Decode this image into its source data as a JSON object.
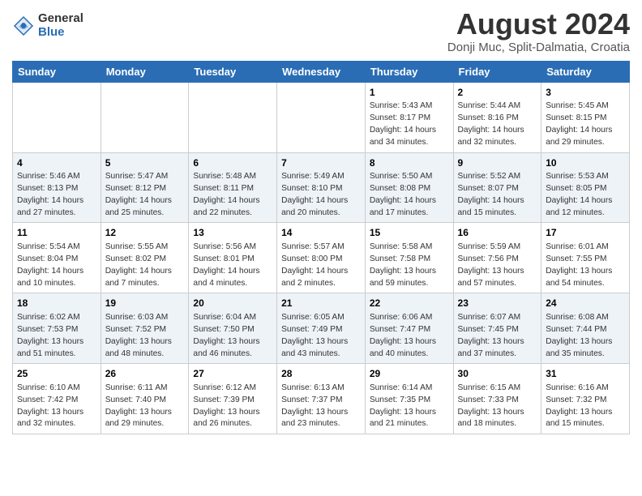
{
  "header": {
    "logo_general": "General",
    "logo_blue": "Blue",
    "month_title": "August 2024",
    "location": "Donji Muc, Split-Dalmatia, Croatia"
  },
  "weekdays": [
    "Sunday",
    "Monday",
    "Tuesday",
    "Wednesday",
    "Thursday",
    "Friday",
    "Saturday"
  ],
  "weeks": [
    [
      {
        "day": "",
        "info": ""
      },
      {
        "day": "",
        "info": ""
      },
      {
        "day": "",
        "info": ""
      },
      {
        "day": "",
        "info": ""
      },
      {
        "day": "1",
        "info": "Sunrise: 5:43 AM\nSunset: 8:17 PM\nDaylight: 14 hours\nand 34 minutes."
      },
      {
        "day": "2",
        "info": "Sunrise: 5:44 AM\nSunset: 8:16 PM\nDaylight: 14 hours\nand 32 minutes."
      },
      {
        "day": "3",
        "info": "Sunrise: 5:45 AM\nSunset: 8:15 PM\nDaylight: 14 hours\nand 29 minutes."
      }
    ],
    [
      {
        "day": "4",
        "info": "Sunrise: 5:46 AM\nSunset: 8:13 PM\nDaylight: 14 hours\nand 27 minutes."
      },
      {
        "day": "5",
        "info": "Sunrise: 5:47 AM\nSunset: 8:12 PM\nDaylight: 14 hours\nand 25 minutes."
      },
      {
        "day": "6",
        "info": "Sunrise: 5:48 AM\nSunset: 8:11 PM\nDaylight: 14 hours\nand 22 minutes."
      },
      {
        "day": "7",
        "info": "Sunrise: 5:49 AM\nSunset: 8:10 PM\nDaylight: 14 hours\nand 20 minutes."
      },
      {
        "day": "8",
        "info": "Sunrise: 5:50 AM\nSunset: 8:08 PM\nDaylight: 14 hours\nand 17 minutes."
      },
      {
        "day": "9",
        "info": "Sunrise: 5:52 AM\nSunset: 8:07 PM\nDaylight: 14 hours\nand 15 minutes."
      },
      {
        "day": "10",
        "info": "Sunrise: 5:53 AM\nSunset: 8:05 PM\nDaylight: 14 hours\nand 12 minutes."
      }
    ],
    [
      {
        "day": "11",
        "info": "Sunrise: 5:54 AM\nSunset: 8:04 PM\nDaylight: 14 hours\nand 10 minutes."
      },
      {
        "day": "12",
        "info": "Sunrise: 5:55 AM\nSunset: 8:02 PM\nDaylight: 14 hours\nand 7 minutes."
      },
      {
        "day": "13",
        "info": "Sunrise: 5:56 AM\nSunset: 8:01 PM\nDaylight: 14 hours\nand 4 minutes."
      },
      {
        "day": "14",
        "info": "Sunrise: 5:57 AM\nSunset: 8:00 PM\nDaylight: 14 hours\nand 2 minutes."
      },
      {
        "day": "15",
        "info": "Sunrise: 5:58 AM\nSunset: 7:58 PM\nDaylight: 13 hours\nand 59 minutes."
      },
      {
        "day": "16",
        "info": "Sunrise: 5:59 AM\nSunset: 7:56 PM\nDaylight: 13 hours\nand 57 minutes."
      },
      {
        "day": "17",
        "info": "Sunrise: 6:01 AM\nSunset: 7:55 PM\nDaylight: 13 hours\nand 54 minutes."
      }
    ],
    [
      {
        "day": "18",
        "info": "Sunrise: 6:02 AM\nSunset: 7:53 PM\nDaylight: 13 hours\nand 51 minutes."
      },
      {
        "day": "19",
        "info": "Sunrise: 6:03 AM\nSunset: 7:52 PM\nDaylight: 13 hours\nand 48 minutes."
      },
      {
        "day": "20",
        "info": "Sunrise: 6:04 AM\nSunset: 7:50 PM\nDaylight: 13 hours\nand 46 minutes."
      },
      {
        "day": "21",
        "info": "Sunrise: 6:05 AM\nSunset: 7:49 PM\nDaylight: 13 hours\nand 43 minutes."
      },
      {
        "day": "22",
        "info": "Sunrise: 6:06 AM\nSunset: 7:47 PM\nDaylight: 13 hours\nand 40 minutes."
      },
      {
        "day": "23",
        "info": "Sunrise: 6:07 AM\nSunset: 7:45 PM\nDaylight: 13 hours\nand 37 minutes."
      },
      {
        "day": "24",
        "info": "Sunrise: 6:08 AM\nSunset: 7:44 PM\nDaylight: 13 hours\nand 35 minutes."
      }
    ],
    [
      {
        "day": "25",
        "info": "Sunrise: 6:10 AM\nSunset: 7:42 PM\nDaylight: 13 hours\nand 32 minutes."
      },
      {
        "day": "26",
        "info": "Sunrise: 6:11 AM\nSunset: 7:40 PM\nDaylight: 13 hours\nand 29 minutes."
      },
      {
        "day": "27",
        "info": "Sunrise: 6:12 AM\nSunset: 7:39 PM\nDaylight: 13 hours\nand 26 minutes."
      },
      {
        "day": "28",
        "info": "Sunrise: 6:13 AM\nSunset: 7:37 PM\nDaylight: 13 hours\nand 23 minutes."
      },
      {
        "day": "29",
        "info": "Sunrise: 6:14 AM\nSunset: 7:35 PM\nDaylight: 13 hours\nand 21 minutes."
      },
      {
        "day": "30",
        "info": "Sunrise: 6:15 AM\nSunset: 7:33 PM\nDaylight: 13 hours\nand 18 minutes."
      },
      {
        "day": "31",
        "info": "Sunrise: 6:16 AM\nSunset: 7:32 PM\nDaylight: 13 hours\nand 15 minutes."
      }
    ]
  ]
}
